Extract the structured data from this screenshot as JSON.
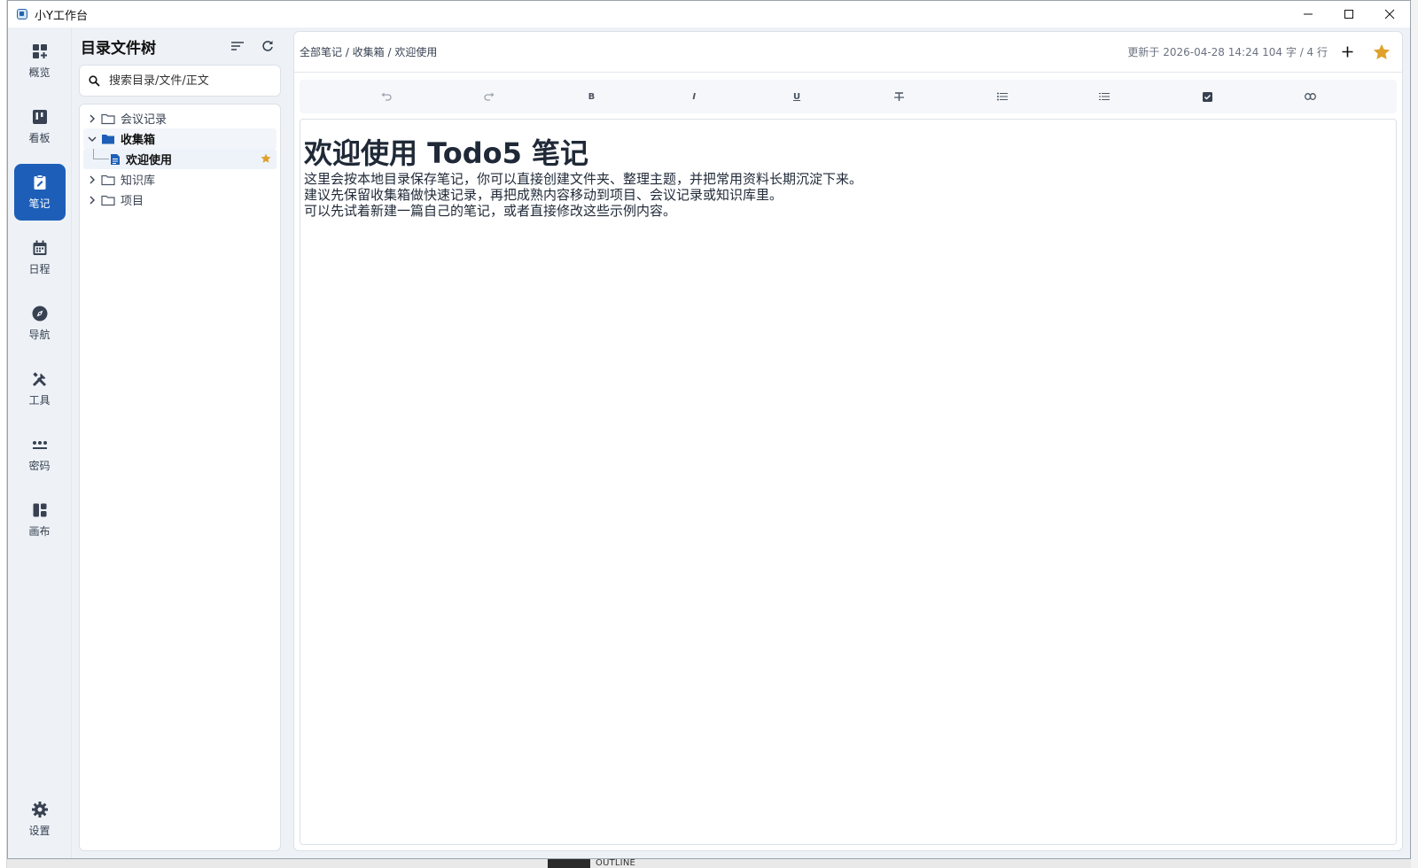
{
  "window": {
    "title": "小Y工作台"
  },
  "nav": {
    "items": [
      {
        "label": "概览",
        "icon": "dashboard-icon"
      },
      {
        "label": "看板",
        "icon": "kanban-icon"
      },
      {
        "label": "笔记",
        "icon": "note-icon",
        "active": true
      },
      {
        "label": "日程",
        "icon": "calendar-icon"
      },
      {
        "label": "导航",
        "icon": "compass-icon"
      },
      {
        "label": "工具",
        "icon": "tools-icon"
      },
      {
        "label": "密码",
        "icon": "password-icon"
      },
      {
        "label": "画布",
        "icon": "canvas-icon"
      }
    ],
    "settings_label": "设置"
  },
  "tree": {
    "title": "目录文件树",
    "search_placeholder": "搜索目录/文件/正文",
    "items": [
      {
        "label": "会议记录",
        "type": "folder",
        "expanded": false
      },
      {
        "label": "收集箱",
        "type": "folder",
        "expanded": true,
        "selected": true
      },
      {
        "label": "欢迎使用",
        "type": "file",
        "starred": true
      },
      {
        "label": "知识库",
        "type": "folder",
        "expanded": false
      },
      {
        "label": "项目",
        "type": "folder",
        "expanded": false
      }
    ]
  },
  "editor": {
    "breadcrumb": "全部笔记 / 收集箱 / 欢迎使用",
    "meta": "更新于 2026-04-28 14:24 104 字 / 4 行",
    "toolbar": {
      "undo": "undo-icon",
      "redo": "redo-icon",
      "bold": "B",
      "italic": "I",
      "underline": "U",
      "strike": "strikethrough-icon",
      "bullet_list": "bullet-list-icon",
      "ordered_list": "ordered-list-icon",
      "task": "checkbox-icon",
      "link": "link-icon"
    },
    "heading": "欢迎使用 Todo5 笔记",
    "paragraphs": [
      "这里会按本地目录保存笔记，你可以直接创建文件夹、整理主题，并把常用资料长期沉淀下来。",
      "建议先保留收集箱做快速记录，再把成熟内容移动到项目、会议记录或知识库里。",
      "可以先试着新建一篇自己的笔记，或者直接修改这些示例内容。"
    ]
  },
  "taskbar": {
    "outline_label": "OUTLINE"
  },
  "colors": {
    "accent": "#1d5fb8",
    "star": "#e0a12b"
  }
}
